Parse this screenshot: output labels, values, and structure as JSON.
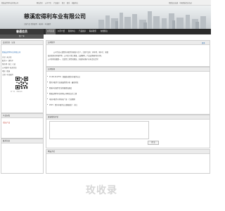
{
  "topbar": {
    "left_text": "慈溪宏得利车业有限公司",
    "links": [
      "网站首页",
      "公司介绍",
      "产品展示",
      "留言",
      "联系",
      "收藏本站"
    ],
    "right_text": "免费会员店铺 · 中国慈溪企业名录"
  },
  "header": {
    "title": "慈溪宏得利车业有限公司",
    "subtitle": "主营产品: 摩托配件 · 电动车 · 车业配件"
  },
  "nav": {
    "brand": "普通会员",
    "items": [
      "公司首页",
      "公司介绍",
      "新闻中心",
      "产品展示",
      "联系我们",
      "在线留言"
    ],
    "active_index": 0,
    "sub_label": "第 7 年"
  },
  "sidebar": {
    "profile": {
      "title": "会员信息 · 认证",
      "company": "慈溪宏得利车业有限公司",
      "fields": [
        "认证: 未认证",
        "联系人: 胡伟平",
        "所在地: 浙江 宁波",
        "公司类型: 私营企业",
        "地区: 慈溪",
        "主营: 车业配件"
      ],
      "qr_caption": "扫一扫 · 手机访问"
    },
    "categories": {
      "title": "产品分类",
      "items": [
        "· 暂无产品"
      ]
    },
    "contact": {
      "title": "联系信息"
    }
  },
  "main": {
    "intro": {
      "title": "公司简介",
      "text_lines": [
        "公司专业从事摩托车配件的研发与生产，主要产品有：刹车蹄、刹车片、轮毂",
        "及各类电动车配件等。公司位于浙江慈溪，交通便利，产品远销国内外市场。",
        "公司坚持质量第一、信誉至上的经营理念，欢迎新老客户来电洽谈合作！"
      ],
      "more_label": "更多"
    },
    "news": {
      "title": "公司新闻",
      "items": [
        "15-08-16 WTO · 积极推动摩托车配件出口",
        "摩托车配件行业发展趋势分析 · 最新消息",
        "慈溪车业配件企业积极参加展会",
        "慈溪宏得利车业有限公司网站正式上线",
        "电动车配件市场前景广阔 · 行业观察",
        "2015 · 摩托车配件出口数据统计 · 浙江"
      ]
    },
    "message": {
      "title": "发表我的评论",
      "submit_label": "提 交"
    },
    "comments": {
      "title": "网友评论"
    }
  },
  "watermark": "玫收录"
}
